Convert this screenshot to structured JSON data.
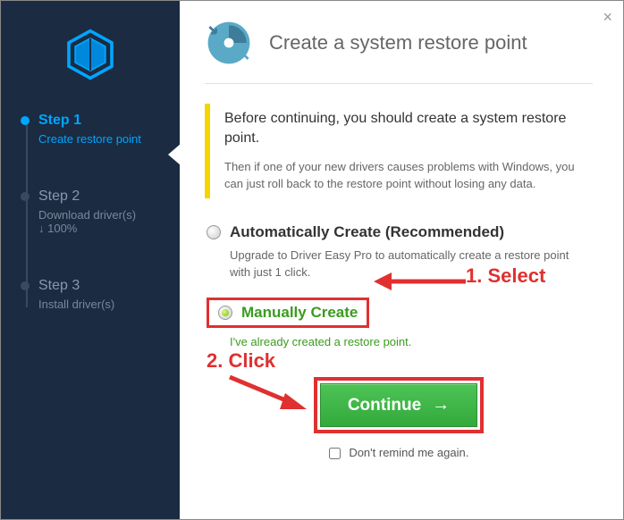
{
  "close_label": "×",
  "header": {
    "title": "Create a system restore point"
  },
  "sidebar": {
    "steps": [
      {
        "title": "Step 1",
        "sub": "Create restore point"
      },
      {
        "title": "Step 2",
        "sub": "Download driver(s)",
        "sub2": "↓ 100%"
      },
      {
        "title": "Step 3",
        "sub": "Install driver(s)"
      }
    ]
  },
  "callout": {
    "title": "Before continuing, you should create a system restore point.",
    "body": "Then if one of your new drivers causes problems with Windows, you can just roll back to the restore point without losing any data."
  },
  "option_auto": {
    "label": "Automatically Create (Recommended)",
    "desc": "Upgrade to Driver Easy Pro to automatically create a restore point with just 1 click."
  },
  "option_manual": {
    "label": "Manually Create",
    "desc": "I've already created a restore point."
  },
  "continue_label": "Continue",
  "remind_label": "Don't remind me again.",
  "annotations": {
    "select": "1. Select",
    "click": "2. Click"
  }
}
